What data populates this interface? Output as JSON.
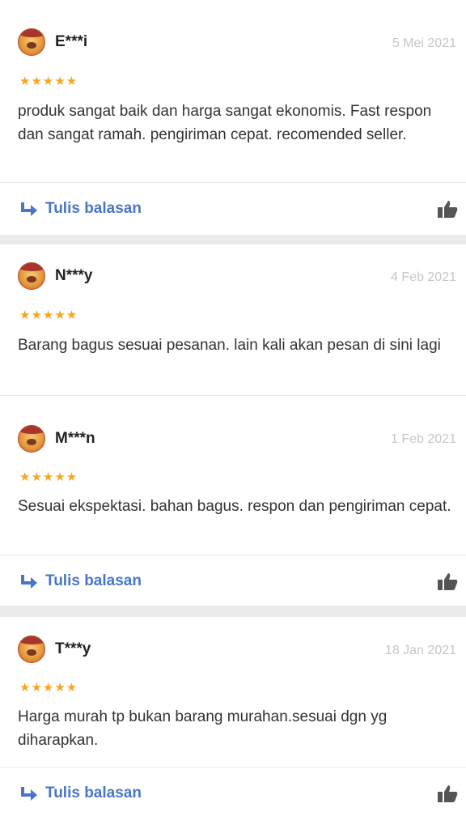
{
  "reviews": [
    {
      "name": "E***i",
      "date": "5 Mei 2021",
      "stars": "★★★★★",
      "text": "produk sangat baik dan harga sangat ekonomis. Fast respon dan sangat ramah. pengiriman cepat. recomended seller.",
      "reply_label": "Tulis balasan"
    },
    {
      "name": "N***y",
      "date": "4 Feb 2021",
      "stars": "★★★★★",
      "text": "Barang bagus sesuai pesanan. lain kali akan pesan di sini lagi"
    },
    {
      "name": "M***n",
      "date": "1 Feb 2021",
      "stars": "★★★★★",
      "text": "Sesuai ekspektasi. bahan bagus. respon dan pengiriman cepat.",
      "reply_label": "Tulis balasan"
    },
    {
      "name": "T***y",
      "date": "18 Jan 2021",
      "stars": "★★★★★",
      "text": "Harga murah tp bukan barang murahan.sesuai dgn yg diharapkan.",
      "reply_label": "Tulis balasan"
    }
  ],
  "colors": {
    "accent": "#4a76c8",
    "star": "#f5a623",
    "date": "#c7c7c7",
    "background": "#ebebeb"
  },
  "icons": {
    "reply": "reply-arrow-icon",
    "like": "thumbs-up-icon",
    "stars": "star-icon"
  }
}
